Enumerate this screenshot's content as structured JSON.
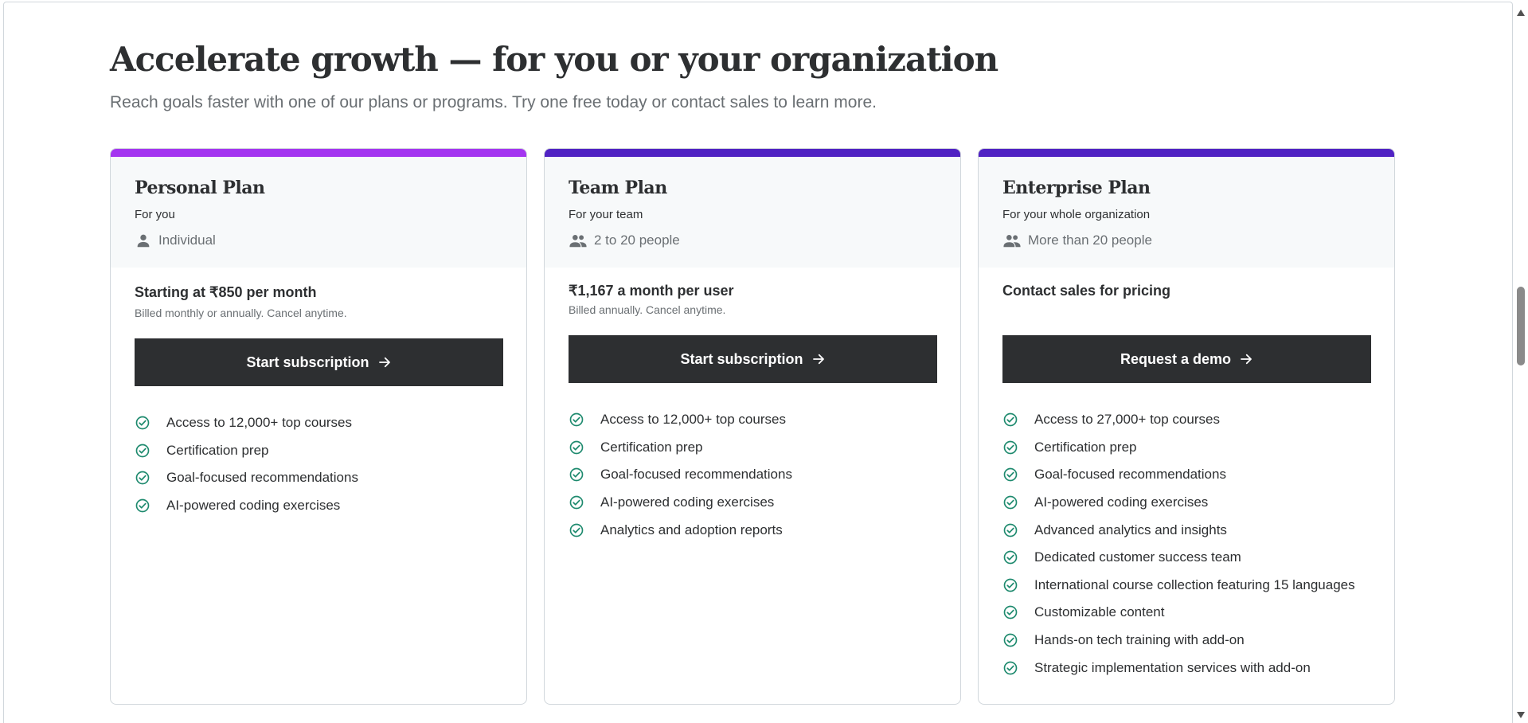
{
  "section": {
    "heading": "Accelerate growth — for you or your organization",
    "subheading": "Reach goals faster with one of our plans or programs. Try one free today or contact sales to learn more."
  },
  "colors": {
    "personal_accent": "#a435f0",
    "team_accent": "#5022c3",
    "enterprise_accent": "#5022c3",
    "check": "#1e8a6e",
    "button_bg": "#2d2f31"
  },
  "plans": [
    {
      "name": "Personal Plan",
      "for": "For you",
      "audience_icon": "person-icon",
      "audience": "Individual",
      "price": "Starting at ₹850 per month",
      "billing": "Billed monthly or annually. Cancel anytime.",
      "cta": "Start subscription",
      "features": [
        "Access to 12,000+ top courses",
        "Certification prep",
        "Goal-focused recommendations",
        "AI-powered coding exercises"
      ]
    },
    {
      "name": "Team Plan",
      "for": "For your team",
      "audience_icon": "people-icon",
      "audience": "2 to 20 people",
      "price": "₹1,167 a month per user",
      "billing": "Billed annually. Cancel anytime.",
      "cta": "Start subscription",
      "features": [
        "Access to 12,000+ top courses",
        "Certification prep",
        "Goal-focused recommendations",
        "AI-powered coding exercises",
        "Analytics and adoption reports"
      ]
    },
    {
      "name": "Enterprise Plan",
      "for": "For your whole organization",
      "audience_icon": "people-icon",
      "audience": "More than 20 people",
      "price": "Contact sales for pricing",
      "cta": "Request a demo",
      "features": [
        "Access to 27,000+ top courses",
        "Certification prep",
        "Goal-focused recommendations",
        "AI-powered coding exercises",
        "Advanced analytics and insights",
        "Dedicated customer success team",
        "International course collection featuring 15 languages",
        "Customizable content",
        "Hands-on tech training with add-on",
        "Strategic implementation services with add-on"
      ]
    }
  ]
}
